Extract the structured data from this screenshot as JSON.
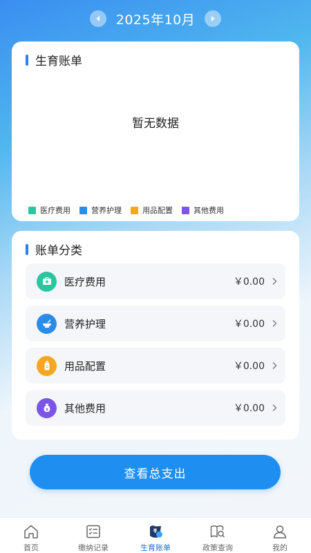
{
  "month_selector": {
    "label": "2025年10月"
  },
  "summary": {
    "title": "生育账单",
    "empty_text": "暂无数据",
    "legend": [
      {
        "label": "医疗费用",
        "color": "#2bc6a0"
      },
      {
        "label": "营养护理",
        "color": "#2d8be8"
      },
      {
        "label": "用品配置",
        "color": "#f5a623"
      },
      {
        "label": "其他费用",
        "color": "#7b55e8"
      }
    ]
  },
  "categories": {
    "title": "账单分类",
    "items": [
      {
        "label": "医疗费用",
        "amount": "￥0.00",
        "icon": "medical-kit-icon",
        "color": "#2bc6a0"
      },
      {
        "label": "营养护理",
        "amount": "￥0.00",
        "icon": "bowl-icon",
        "color": "#2d8be8"
      },
      {
        "label": "用品配置",
        "amount": "￥0.00",
        "icon": "bottle-icon",
        "color": "#f5a623"
      },
      {
        "label": "其他费用",
        "amount": "￥0.00",
        "icon": "money-bag-icon",
        "color": "#7b55e8"
      }
    ]
  },
  "total_button": {
    "label": "查看总支出"
  },
  "nav": {
    "items": [
      {
        "label": "首页",
        "icon": "home-icon"
      },
      {
        "label": "缴纳记录",
        "icon": "checklist-icon"
      },
      {
        "label": "生育账单",
        "icon": "bill-icon",
        "active": true
      },
      {
        "label": "政策查询",
        "icon": "book-search-icon"
      },
      {
        "label": "我的",
        "icon": "user-icon"
      }
    ]
  }
}
